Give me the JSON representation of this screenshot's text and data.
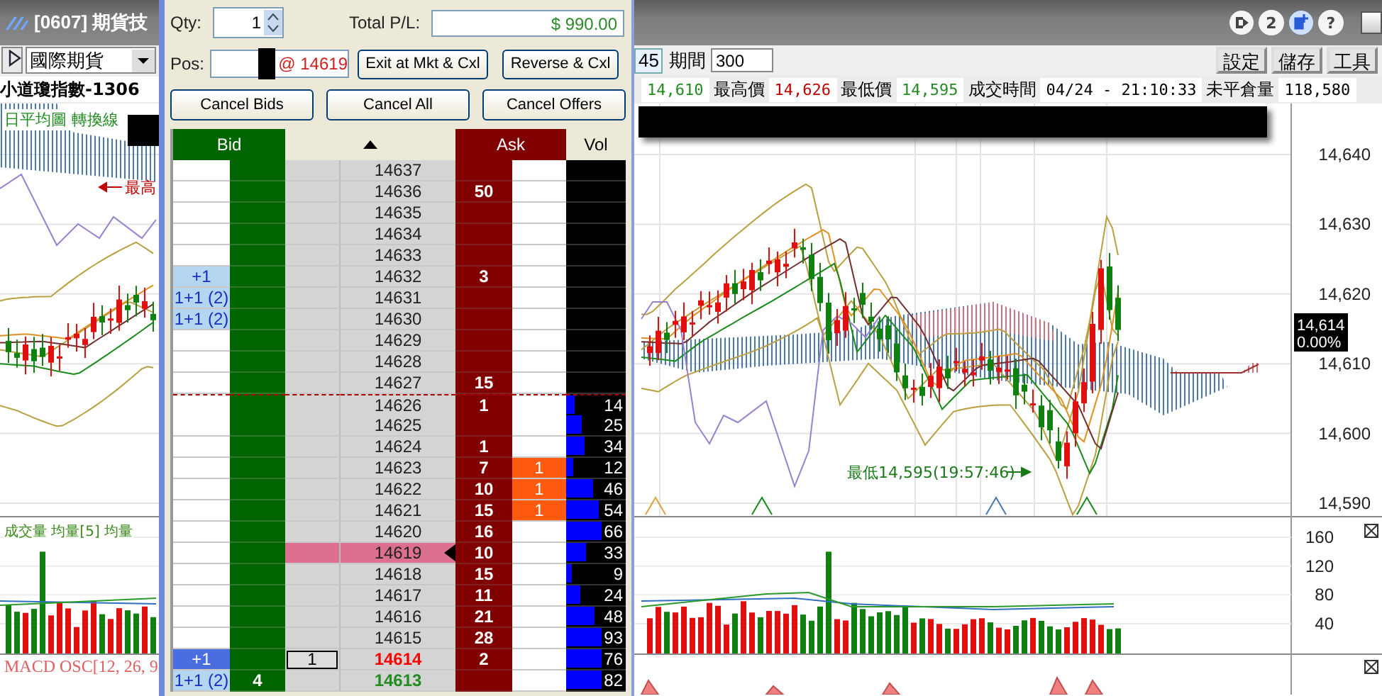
{
  "window": {
    "title": "[0607] 期貨技"
  },
  "title_buttons": [
    {
      "kind": "exit"
    },
    {
      "kind": "text",
      "label": "2"
    },
    {
      "kind": "add"
    },
    {
      "kind": "text",
      "label": "?"
    },
    {
      "kind": "minimize"
    }
  ],
  "toolbar": {
    "market": "國際期貨",
    "interval": "45",
    "period_label": "期間",
    "period": "300",
    "buttons": [
      "設定",
      "儲存",
      "工具"
    ]
  },
  "symbol": "小道瓊指數-1306",
  "quote": [
    {
      "value": "14,610",
      "color": "#228b22"
    },
    {
      "label": "最高價",
      "value": "14,626",
      "color": "#c00000"
    },
    {
      "label": "最低價",
      "value": "14,595",
      "color": "#228b22"
    },
    {
      "label": "成交時間",
      "value": "04/24 - 21:10:33",
      "color": "#000000"
    },
    {
      "label": "未平倉量",
      "value": "118,580",
      "color": "#000000"
    }
  ],
  "chart": {
    "legend": "日平均圖 轉換線",
    "high_label": "最高",
    "low_label": "最低14,595(19:57:46)",
    "price_ticks": [
      "14,640",
      "14,630",
      "14,620",
      "14,610",
      "14,600",
      "14,590"
    ],
    "last_price": "14,614",
    "change": "0.00%"
  },
  "volume": {
    "legend": "成交量 均量[5] 均量",
    "ticks": [
      "160",
      "120",
      "80",
      "40"
    ]
  },
  "macd": {
    "legend": "MACD OSC[12, 26, 9"
  },
  "ladder": {
    "qty_label": "Qty:",
    "qty": "1",
    "pl_label": "Total P/L:",
    "pl": "$ 990.00",
    "pos_label": "Pos:",
    "pos_price": "@ 14619",
    "actions": [
      "Exit at Mkt & Cxl",
      "Reverse & Cxl"
    ],
    "cancel_buttons": [
      "Cancel Bids",
      "Cancel All",
      "Cancel Offers"
    ],
    "columns": [
      {
        "kind": "bid",
        "label": "Bid"
      },
      {
        "kind": "sort"
      },
      {
        "kind": "ask",
        "label": "Ask"
      },
      {
        "kind": "vol",
        "label": "Vol"
      }
    ],
    "rows": [
      {
        "price": "14637",
        "selected": false,
        "last": false,
        "line": false
      },
      {
        "price": "14636",
        "ask": "50",
        "selected": false,
        "last": false,
        "line": false
      },
      {
        "price": "14635",
        "selected": false,
        "last": false,
        "line": false
      },
      {
        "price": "14634",
        "selected": false,
        "last": false,
        "line": false
      },
      {
        "price": "14633",
        "selected": false,
        "last": false,
        "line": false
      },
      {
        "price": "14632",
        "my_bids": "+1",
        "ask": "3",
        "selected": false,
        "last": false,
        "line": false
      },
      {
        "price": "14631",
        "my_bids": "1+1 (2)",
        "selected": false,
        "last": false,
        "line": false
      },
      {
        "price": "14630",
        "my_bids": "1+1 (2)",
        "selected": false,
        "last": false,
        "line": false
      },
      {
        "price": "14629",
        "selected": false,
        "last": false,
        "line": false
      },
      {
        "price": "14628",
        "selected": false,
        "last": false,
        "line": false
      },
      {
        "price": "14627",
        "ask": "15",
        "selected": false,
        "last": false,
        "line": false
      },
      {
        "price": "14626",
        "ask": "1",
        "vol": "14",
        "level": 0.14,
        "selected": false,
        "last": false,
        "line": true
      },
      {
        "price": "14625",
        "vol": "25",
        "level": 0.25,
        "selected": false,
        "last": false,
        "line": false
      },
      {
        "price": "14624",
        "ask": "1",
        "vol": "34",
        "level": 0.3,
        "selected": false,
        "last": false,
        "line": false
      },
      {
        "price": "14623",
        "ask": "7",
        "my_asks": "1",
        "vol": "12",
        "level": 0.12,
        "selected": false,
        "last": false,
        "line": false
      },
      {
        "price": "14622",
        "ask": "10",
        "my_asks": "1",
        "vol": "46",
        "level": 0.46,
        "selected": false,
        "last": false,
        "line": false
      },
      {
        "price": "14621",
        "ask": "15",
        "my_asks": "1",
        "vol": "54",
        "level": 0.54,
        "selected": false,
        "last": false,
        "line": false
      },
      {
        "price": "14620",
        "ask": "16",
        "vol": "66",
        "level": 0.66,
        "selected": false,
        "last": false,
        "line": false
      },
      {
        "price": "14619",
        "ask": "10",
        "vol": "33",
        "level": 0.33,
        "selected": false,
        "last": true,
        "line": false
      },
      {
        "price": "14618",
        "ask": "15",
        "vol": "9",
        "level": 0.09,
        "selected": false,
        "last": false,
        "line": false
      },
      {
        "price": "14617",
        "ask": "11",
        "vol": "24",
        "level": 0.24,
        "selected": false,
        "last": false,
        "line": false
      },
      {
        "price": "14616",
        "ask": "21",
        "vol": "48",
        "level": 0.48,
        "selected": false,
        "last": false,
        "line": false
      },
      {
        "price": "14615",
        "ask": "28",
        "vol": "93",
        "level": 0.93,
        "selected": false,
        "last": false,
        "line": false
      },
      {
        "price": "14614",
        "my_bids": "+1",
        "my_order": "1",
        "ask": "2",
        "vol": "76",
        "level": 0.76,
        "color": "#ff0000",
        "selected": true,
        "last": false,
        "line": false
      },
      {
        "price": "14613",
        "my_bids": "1+1 (2)",
        "bid": "4",
        "vol": "82",
        "level": 0.82,
        "color": "#228b22",
        "selected": false,
        "last": false,
        "line": false
      }
    ]
  }
}
